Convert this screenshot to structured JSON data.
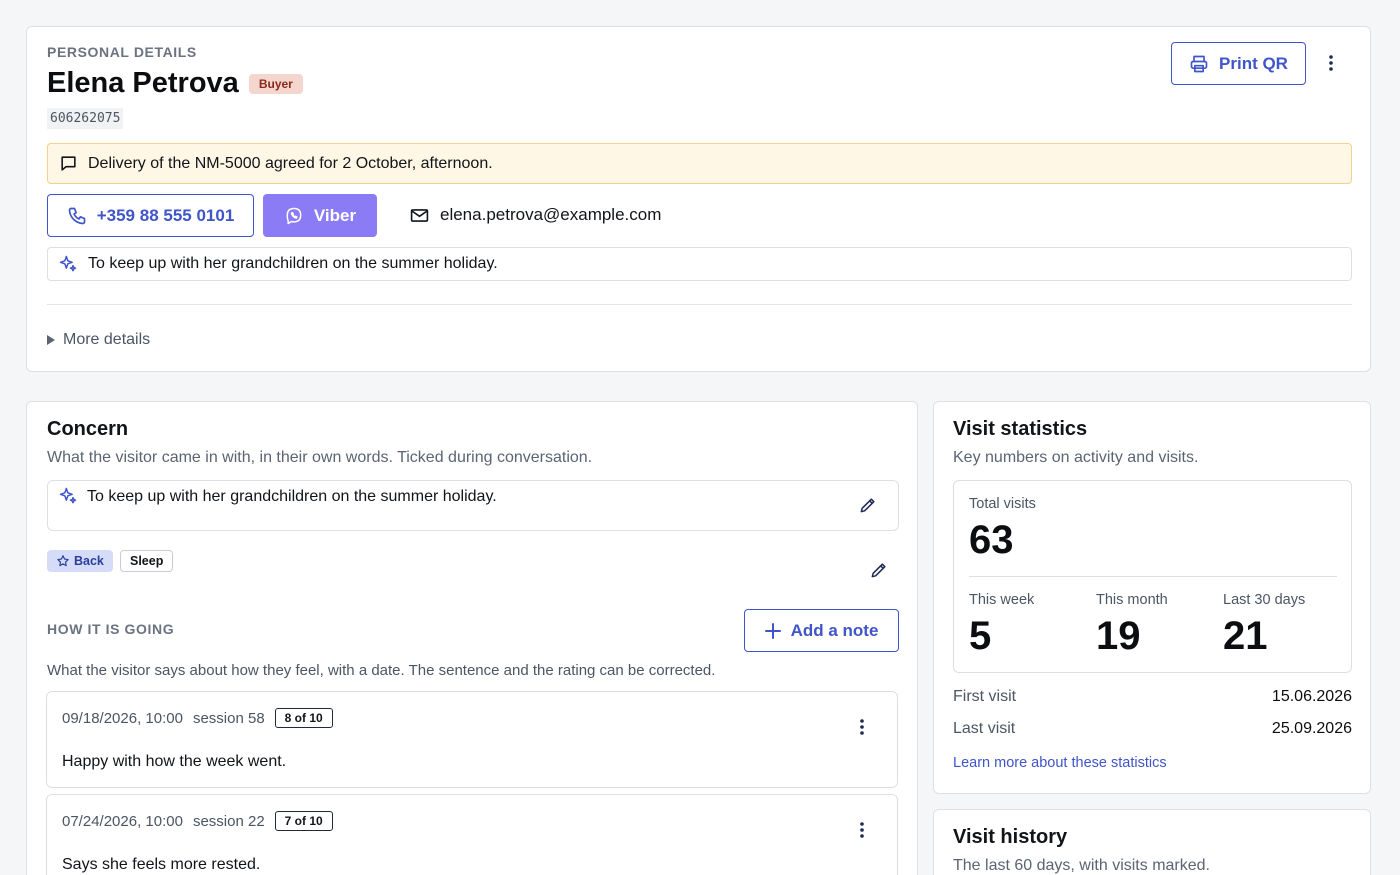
{
  "personal": {
    "section_label": "PERSONAL DETAILS",
    "name": "Elena Petrova",
    "role_badge": "Buyer",
    "customer_id": "606262075",
    "print_qr_label": "Print QR",
    "note": "Delivery of the NM-5000 agreed for 2 October, afternoon.",
    "phone": "+359 88 555 0101",
    "viber_label": "Viber",
    "email": "elena.petrova@example.com",
    "goal": "To keep up with her grandchildren on the summer holiday.",
    "more_details_label": "More details"
  },
  "concern": {
    "title": "Concern",
    "subtitle": "What the visitor came in with, in their own words. Ticked during conversation.",
    "goal": "To keep up with her grandchildren on the summer holiday.",
    "tags": [
      {
        "label": "Back",
        "starred": true
      },
      {
        "label": "Sleep",
        "starred": false
      }
    ],
    "progress_label": "HOW IT IS GOING",
    "add_note_label": "Add a note",
    "progress_subtitle": "What the visitor says about how they feel, with a date. The sentence and the rating can be corrected.",
    "notes": [
      {
        "datetime": "09/18/2026, 10:00",
        "session": "session 58",
        "rating": "8 of 10",
        "text": "Happy with how the week went."
      },
      {
        "datetime": "07/24/2026, 10:00",
        "session": "session 22",
        "rating": "7 of 10",
        "text": "Says she feels more rested."
      }
    ]
  },
  "stats": {
    "title": "Visit statistics",
    "subtitle": "Key numbers on activity and visits.",
    "total_label": "Total visits",
    "total_value": "63",
    "week_label": "This week",
    "week_value": "5",
    "month_label": "This month",
    "month_value": "19",
    "last30_label": "Last 30 days",
    "last30_value": "21",
    "first_visit_label": "First visit",
    "first_visit_value": "15.06.2026",
    "last_visit_label": "Last visit",
    "last_visit_value": "25.09.2026",
    "learn_more_label": "Learn more about these statistics"
  },
  "history": {
    "title": "Visit history",
    "subtitle": "The last 60 days, with visits marked."
  },
  "colors": {
    "accent": "#3f55c9",
    "viber": "#8b7cf6",
    "note_bg": "#fff7e6",
    "note_border": "#f3d28a",
    "buyer_badge_bg": "#f4d6cf",
    "buyer_badge_text": "#8a2a1a",
    "tag_starred_bg": "#d4dcf7"
  }
}
